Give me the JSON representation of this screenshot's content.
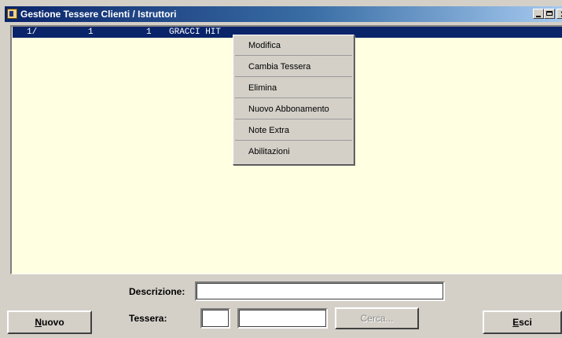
{
  "window": {
    "title": "Gestione Tessere Clienti / Istruttori",
    "controls": [
      "minimize-icon",
      "maximize-icon",
      "close-icon"
    ]
  },
  "list": {
    "rows": [
      {
        "col1": "1/",
        "col2": "1",
        "col3": "1",
        "name": "GRACCI HIT",
        "selected": true
      }
    ],
    "background_color": "#ffffe1",
    "selection_color": "#0a246a"
  },
  "context_menu": {
    "items": [
      {
        "label": "Modifica"
      },
      {
        "label": "Cambia Tessera"
      },
      {
        "label": "Elimina"
      },
      {
        "label": "Nuovo Abbonamento"
      },
      {
        "label": "Note Extra"
      },
      {
        "label": "Abilitazioni"
      }
    ]
  },
  "form": {
    "descrizione_label": "Descrizione:",
    "descrizione_value": "",
    "tessera_label": "Tessera:",
    "tessera_prefix_value": "",
    "tessera_number_value": ""
  },
  "buttons": {
    "nuovo_label_accel": "N",
    "nuovo_label_rest": "uovo",
    "cerca_label": "Cerca...",
    "esci_label_accel": "E",
    "esci_label_rest": "sci"
  }
}
